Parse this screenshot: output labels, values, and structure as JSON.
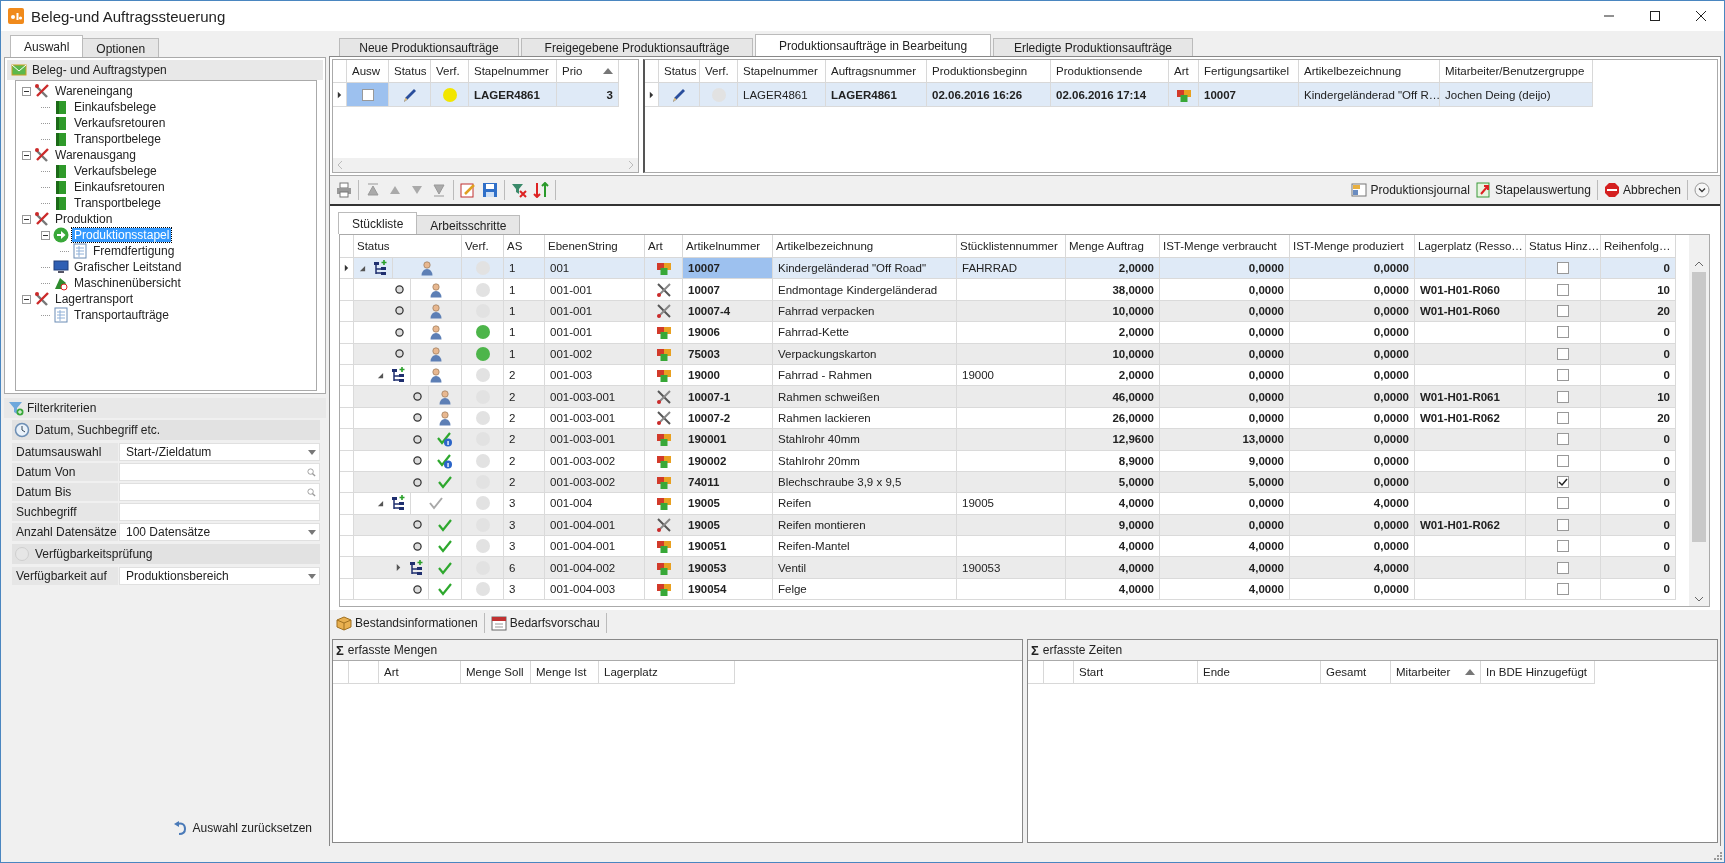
{
  "window": {
    "title": "Beleg-und Auftragssteuerung"
  },
  "left_tabs": [
    {
      "label": "Auswahl",
      "selected": true
    },
    {
      "label": "Optionen",
      "selected": false
    }
  ],
  "tree": {
    "title": "Beleg- und Auftragstypen",
    "items": [
      {
        "label": "Wareneingang",
        "kind": "tools",
        "expanded": true,
        "selected": false,
        "children": [
          {
            "label": "Einkaufsbelege",
            "kind": "book",
            "selected": false
          },
          {
            "label": "Verkaufsretouren",
            "kind": "book",
            "selected": false
          },
          {
            "label": "Transportbelege",
            "kind": "book",
            "selected": false
          }
        ]
      },
      {
        "label": "Warenausgang",
        "kind": "tools",
        "expanded": true,
        "selected": false,
        "children": [
          {
            "label": "Verkaufsbelege",
            "kind": "book",
            "selected": false
          },
          {
            "label": "Einkaufsretouren",
            "kind": "book",
            "selected": false
          },
          {
            "label": "Transportbelege",
            "kind": "book",
            "selected": false
          }
        ]
      },
      {
        "label": "Produktion",
        "kind": "tools",
        "expanded": true,
        "selected": false,
        "children": [
          {
            "label": "Produktionsstapel",
            "kind": "arrow",
            "expanded": true,
            "selected": true,
            "children": [
              {
                "label": "Fremdfertigung",
                "kind": "doc",
                "selected": false
              }
            ]
          },
          {
            "label": "Grafischer Leitstand",
            "kind": "monitor",
            "selected": false
          },
          {
            "label": "Maschinenübersicht",
            "kind": "machine",
            "selected": false
          }
        ]
      },
      {
        "label": "Lagertransport",
        "kind": "tools",
        "expanded": true,
        "selected": false,
        "children": [
          {
            "label": "Transportaufträge",
            "kind": "doc",
            "selected": false
          }
        ]
      }
    ]
  },
  "filter": {
    "title": "Filterkriterien",
    "groups": [
      {
        "title": "Datum, Suchbegriff etc.",
        "kind": "clock",
        "fields": [
          {
            "label": "Datumsauswahl",
            "kind": "dropdown",
            "value": "Start-/Zieldatum"
          },
          {
            "label": "Datum Von",
            "kind": "search"
          },
          {
            "label": "Datum Bis",
            "kind": "search"
          },
          {
            "label": "Suchbegriff",
            "kind": "text"
          },
          {
            "label": "Anzahl Datensätze",
            "kind": "dropdown",
            "value": "100 Datensätze"
          }
        ]
      },
      {
        "title": "Verfügbarkeitsprüfung",
        "kind": "circle",
        "fields": [
          {
            "label": "Verfügbarkeit auf",
            "kind": "dropdown",
            "value": "Produktionsbereich"
          }
        ]
      }
    ]
  },
  "reset_button": "Auswahl zurücksetzen",
  "main_tabs": [
    {
      "label": "Neue Produktionsaufträge",
      "selected": false
    },
    {
      "label": "Freigegebene Produktionsaufträge",
      "selected": false
    },
    {
      "label": "Produktionsaufträge in Bearbeitung",
      "selected": true
    },
    {
      "label": "Erledigte Produktionsaufträge",
      "selected": false
    }
  ],
  "batch_grid": {
    "columns": [
      {
        "label": "Ausw"
      },
      {
        "label": "Status"
      },
      {
        "label": "Verf."
      },
      {
        "label": "Stapelnummer"
      },
      {
        "label": "Prio",
        "sorted": true
      }
    ],
    "rows": [
      {
        "checked": false,
        "status": {
          "kind": "pen"
        },
        "verf": {
          "color": "#f2e600"
        },
        "stapelnummer": "LAGER4861",
        "prio": "3",
        "selected": true
      }
    ]
  },
  "order_grid": {
    "columns": [
      {
        "label": "Status"
      },
      {
        "label": "Verf."
      },
      {
        "label": "Stapelnummer"
      },
      {
        "label": "Auftragsnummer"
      },
      {
        "label": "Produktionsbeginn"
      },
      {
        "label": "Produktionsende"
      },
      {
        "label": "Art"
      },
      {
        "label": "Fertigungsartikel"
      },
      {
        "label": "Artikelbezeichnung"
      },
      {
        "label": "Mitarbeiter/Benutzergruppe"
      }
    ],
    "rows": [
      {
        "status": {
          "kind": "pen"
        },
        "verf": {
          "color": "#e2e2e2"
        },
        "stapelnummer": "LAGER4861",
        "auftragsnummer": "LAGER4861",
        "beginn": "02.06.2016 16:26",
        "ende": "02.06.2016 17:14",
        "art": {
          "kind": "part"
        },
        "fertigungsartikel": "10007",
        "bezeichnung": "Kindergeländerad \"Off R…",
        "mitarbeiter": "Jochen Deing (deijo)",
        "selected": true
      }
    ]
  },
  "toolbar": {
    "buttons": [
      {
        "label": "Produktionsjournal",
        "kind": "journal"
      },
      {
        "label": "Stapelauswertung",
        "kind": "report"
      },
      {
        "label": "Abbrechen",
        "kind": "stop"
      }
    ]
  },
  "sub_tabs": [
    {
      "label": "Stückliste",
      "selected": true
    },
    {
      "label": "Arbeitsschritte",
      "selected": false
    }
  ],
  "bom": {
    "columns": [
      "Status",
      "Verf.",
      "AS",
      "EbenenString",
      "Art",
      "Artikelnummer",
      "Artikelbezeichnung",
      "Stücklistennummer",
      "Menge Auftrag",
      "IST-Menge verbraucht",
      "IST-Menge produziert",
      "Lagerplatz (Resso…",
      "Status Hinz…",
      "Reihenfolg…"
    ],
    "rows": [
      {
        "kind": "group",
        "expanded": true,
        "selected": true,
        "status": {
          "kind": "user"
        },
        "verf": {
          "color": "#e2e2e2"
        },
        "as": "1",
        "ebene": "001",
        "art": {
          "kind": "part"
        },
        "nr": "10007",
        "bez": "Kindergeländerad \"Off Road\"",
        "stl": "FAHRRAD",
        "menge": "2,0000",
        "ist_v": "0,0000",
        "ist_p": "0,0000",
        "hinz": false,
        "reihen": "0",
        "children": [
          {
            "kind": "leaf",
            "selected": false,
            "status": {
              "kind": "user"
            },
            "verf": {
              "color": "#e2e2e2"
            },
            "as": "1",
            "ebene": "001-001",
            "art": {
              "kind": "tool"
            },
            "nr": "10007",
            "bez": "Endmontage Kindergeländerad",
            "menge": "38,0000",
            "ist_v": "0,0000",
            "ist_p": "0,0000",
            "lager": "W01-H01-R060",
            "hinz": false,
            "reihen": "10"
          },
          {
            "kind": "leaf",
            "selected": false,
            "status": {
              "kind": "user"
            },
            "verf": {
              "color": "#e2e2e2"
            },
            "as": "1",
            "ebene": "001-001",
            "art": {
              "kind": "tool"
            },
            "nr": "10007-4",
            "bez": "Fahrrad verpacken",
            "menge": "10,0000",
            "ist_v": "0,0000",
            "ist_p": "0,0000",
            "lager": "W01-H01-R060",
            "hinz": false,
            "reihen": "20"
          },
          {
            "kind": "leaf",
            "selected": false,
            "status": {
              "kind": "user"
            },
            "verf": {
              "color": "#4db54a"
            },
            "as": "1",
            "ebene": "001-001",
            "art": {
              "kind": "part"
            },
            "nr": "19006",
            "bez": "Fahrrad-Kette",
            "menge": "2,0000",
            "ist_v": "0,0000",
            "ist_p": "0,0000",
            "hinz": false,
            "reihen": "0"
          },
          {
            "kind": "leaf",
            "selected": false,
            "status": {
              "kind": "user"
            },
            "verf": {
              "color": "#4db54a"
            },
            "as": "1",
            "ebene": "001-002",
            "art": {
              "kind": "part"
            },
            "nr": "75003",
            "bez": "Verpackungskarton",
            "menge": "10,0000",
            "ist_v": "0,0000",
            "ist_p": "0,0000",
            "hinz": false,
            "reihen": "0"
          },
          {
            "kind": "group",
            "expanded": true,
            "selected": false,
            "status": {
              "kind": "user"
            },
            "verf": {
              "color": "#e2e2e2"
            },
            "as": "2",
            "ebene": "001-003",
            "art": {
              "kind": "part"
            },
            "nr": "19000",
            "bez": "Fahrrad - Rahmen",
            "stl": "19000",
            "menge": "2,0000",
            "ist_v": "0,0000",
            "ist_p": "0,0000",
            "hinz": false,
            "reihen": "0",
            "children": [
              {
                "kind": "leaf",
                "selected": false,
                "status": {
                  "kind": "user"
                },
                "verf": {
                  "color": "#e2e2e2"
                },
                "as": "2",
                "ebene": "001-003-001",
                "art": {
                  "kind": "tool"
                },
                "nr": "10007-1",
                "bez": "Rahmen schweißen",
                "menge": "46,0000",
                "ist_v": "0,0000",
                "ist_p": "0,0000",
                "lager": "W01-H01-R061",
                "hinz": false,
                "reihen": "10"
              },
              {
                "kind": "leaf",
                "selected": false,
                "status": {
                  "kind": "user"
                },
                "verf": {
                  "color": "#e2e2e2"
                },
                "as": "2",
                "ebene": "001-003-001",
                "art": {
                  "kind": "tool"
                },
                "nr": "10007-2",
                "bez": "Rahmen lackieren",
                "menge": "26,0000",
                "ist_v": "0,0000",
                "ist_p": "0,0000",
                "lager": "W01-H01-R062",
                "hinz": false,
                "reihen": "20"
              },
              {
                "kind": "leaf",
                "selected": false,
                "status": {
                  "kind": "check_info"
                },
                "verf": {
                  "color": "#e2e2e2"
                },
                "as": "2",
                "ebene": "001-003-001",
                "art": {
                  "kind": "part"
                },
                "nr": "190001",
                "bez": "Stahlrohr 40mm",
                "menge": "12,9600",
                "ist_v": "13,0000",
                "ist_p": "0,0000",
                "hinz": false,
                "reihen": "0"
              },
              {
                "kind": "leaf",
                "selected": false,
                "status": {
                  "kind": "check_info"
                },
                "verf": {
                  "color": "#e2e2e2"
                },
                "as": "2",
                "ebene": "001-003-002",
                "art": {
                  "kind": "part"
                },
                "nr": "190002",
                "bez": "Stahlrohr 20mm",
                "menge": "8,9000",
                "ist_v": "9,0000",
                "ist_p": "0,0000",
                "hinz": false,
                "reihen": "0"
              },
              {
                "kind": "leaf",
                "selected": false,
                "status": {
                  "kind": "check"
                },
                "verf": {
                  "color": "#e2e2e2"
                },
                "as": "2",
                "ebene": "001-003-002",
                "art": {
                  "kind": "part"
                },
                "nr": "74011",
                "bez": "Blechschraube 3,9 x 9,5",
                "menge": "5,0000",
                "ist_v": "5,0000",
                "ist_p": "0,0000",
                "hinz": true,
                "reihen": "0"
              }
            ]
          },
          {
            "kind": "group",
            "expanded": true,
            "selected": false,
            "status": {
              "kind": "check_grey"
            },
            "verf": {
              "color": "#e2e2e2"
            },
            "as": "3",
            "ebene": "001-004",
            "art": {
              "kind": "part"
            },
            "nr": "19005",
            "bez": "Reifen",
            "stl": "19005",
            "menge": "4,0000",
            "ist_v": "0,0000",
            "ist_p": "4,0000",
            "hinz": false,
            "reihen": "0",
            "children": [
              {
                "kind": "leaf",
                "selected": false,
                "status": {
                  "kind": "check"
                },
                "verf": {
                  "color": "#e2e2e2"
                },
                "as": "3",
                "ebene": "001-004-001",
                "art": {
                  "kind": "tool"
                },
                "nr": "19005",
                "bez": "Reifen montieren",
                "menge": "9,0000",
                "ist_v": "0,0000",
                "ist_p": "0,0000",
                "lager": "W01-H01-R062",
                "hinz": false,
                "reihen": "0"
              },
              {
                "kind": "leaf",
                "selected": false,
                "status": {
                  "kind": "check"
                },
                "verf": {
                  "color": "#e2e2e2"
                },
                "as": "3",
                "ebene": "001-004-001",
                "art": {
                  "kind": "part"
                },
                "nr": "190051",
                "bez": "Reifen-Mantel",
                "menge": "4,0000",
                "ist_v": "4,0000",
                "ist_p": "0,0000",
                "hinz": false,
                "reihen": "0"
              },
              {
                "kind": "group",
                "expanded": false,
                "selected": false,
                "status": {
                  "kind": "check"
                },
                "verf": {
                  "color": "#e2e2e2"
                },
                "as": "6",
                "ebene": "001-004-002",
                "art": {
                  "kind": "part"
                },
                "nr": "190053",
                "bez": "Ventil",
                "stl": "190053",
                "menge": "4,0000",
                "ist_v": "4,0000",
                "ist_p": "4,0000",
                "hinz": false,
                "reihen": "0"
              },
              {
                "kind": "leaf",
                "selected": false,
                "status": {
                  "kind": "check"
                },
                "verf": {
                  "color": "#e2e2e2"
                },
                "as": "3",
                "ebene": "001-004-003",
                "art": {
                  "kind": "part"
                },
                "nr": "190054",
                "bez": "Felge",
                "menge": "4,0000",
                "ist_v": "4,0000",
                "ist_p": "0,0000",
                "hinz": false,
                "reihen": "0"
              }
            ]
          }
        ]
      }
    ]
  },
  "info_buttons": [
    {
      "label": "Bestandsinformationen",
      "kind": "box"
    },
    {
      "label": "Bedarfsvorschau",
      "kind": "calendar"
    }
  ],
  "quantities_panel": {
    "sum_symbol": "Σ",
    "title": "erfasste Mengen",
    "columns": [
      {
        "label": "Art"
      },
      {
        "label": "Menge Soll"
      },
      {
        "label": "Menge Ist"
      },
      {
        "label": "Lagerplatz"
      }
    ]
  },
  "times_panel": {
    "sum_symbol": "Σ",
    "title": "erfasste Zeiten",
    "columns": [
      {
        "label": "Start"
      },
      {
        "label": "Ende"
      },
      {
        "label": "Gesamt"
      },
      {
        "label": "Mitarbeiter",
        "sorted": true
      },
      {
        "label": "In BDE Hinzugefügt"
      }
    ]
  }
}
